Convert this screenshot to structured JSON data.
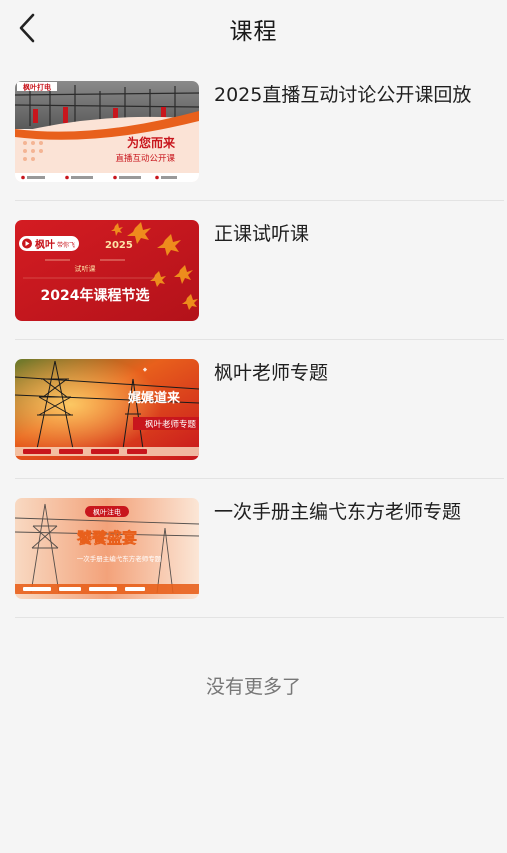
{
  "header": {
    "title": "课程",
    "back_icon": "chevron-left-icon"
  },
  "courses": [
    {
      "title": "2025直播互动讨论公开课回放",
      "thumb": {
        "slogan": "为您而来",
        "subtitle": "直播互动公开课",
        "brand": "枫叶打电"
      }
    },
    {
      "title": "正课试听课",
      "thumb": {
        "brand": "枫叶",
        "brand_suffix": "带你飞",
        "year": "2025",
        "tag": "试听课",
        "headline": "2024年课程节选"
      }
    },
    {
      "title": "枫叶老师专题",
      "thumb": {
        "slogan": "娓娓道来",
        "subtitle": "枫叶老师专题"
      }
    },
    {
      "title": "一次手册主编弋东方老师专题",
      "thumb": {
        "brand": "枫叶注电",
        "slogan": "饕餮盛宴",
        "subtitle": "一次手册主编弋东方老师专题"
      }
    }
  ],
  "footer": {
    "no_more": "没有更多了"
  },
  "colors": {
    "background": "#f5f5f5",
    "divider": "#e3e3e3",
    "brand_red": "#c8161d",
    "brand_orange": "#e8601c"
  }
}
